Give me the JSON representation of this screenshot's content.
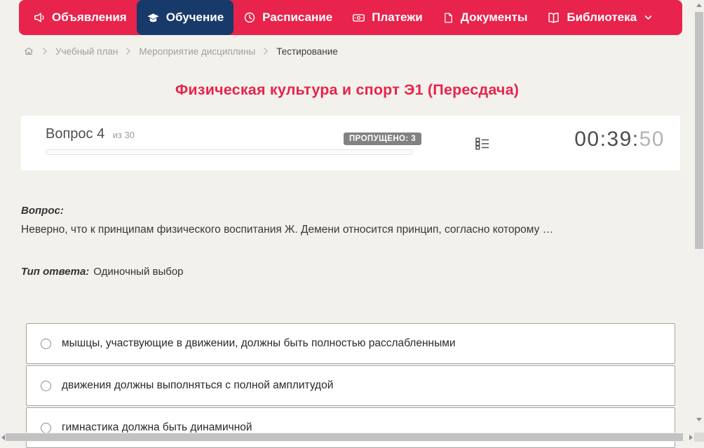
{
  "nav": {
    "items": [
      {
        "label": "Объявления",
        "active": false
      },
      {
        "label": "Обучение",
        "active": true
      },
      {
        "label": "Расписание",
        "active": false
      },
      {
        "label": "Платежи",
        "active": false
      },
      {
        "label": "Документы",
        "active": false
      },
      {
        "label": "Библиотека",
        "active": false,
        "has_dropdown": true
      }
    ]
  },
  "breadcrumb": {
    "items": [
      "Учебный план",
      "Мероприятие дисциплины",
      "Тестирование"
    ]
  },
  "page": {
    "title": "Физическая культура и спорт Э1 (Пересдача)"
  },
  "question_header": {
    "number_label": "Вопрос 4",
    "total_label": "из 30",
    "skipped_badge": "ПРОПУЩЕНО: 3",
    "timer_hm": "00:39:",
    "timer_s": "50",
    "progress_percent": 0
  },
  "question": {
    "label": "Вопрос:",
    "text": "Неверно, что к принципам физического воспитания Ж. Демени относится принцип, согласно которому …",
    "answer_type_label": "Тип ответа:",
    "answer_type": "Одиночный выбор"
  },
  "answers": [
    {
      "text": "мышцы, участвующие в движении, должны быть полностью расслабленными",
      "selected": false
    },
    {
      "text": "движения должны выполняться с полной амплитудой",
      "selected": false
    },
    {
      "text": "гимнастика должна быть динамичной",
      "selected": false
    }
  ],
  "icons": {
    "megaphone-icon": "megaphone",
    "graduation-cap-icon": "graduation cap",
    "clock-icon": "clock",
    "payments-icon": "banknote",
    "documents-icon": "file page",
    "library-icon": "open book",
    "chevron-down-icon": "chevron down",
    "home-icon": "house outline",
    "chevron-right-icon": "chevron right",
    "question-list-icon": "bulleted list",
    "radio-icon": "empty radio circle"
  },
  "colors": {
    "accent_red": "#e8234c",
    "active_navy": "#183a6b",
    "page_bg": "#f2f1ec",
    "badge_gray": "#828282",
    "timer_dark": "#4d4d4d",
    "timer_light": "#b3b3b3",
    "scrollbar_thumb": "#c2c2c2"
  }
}
